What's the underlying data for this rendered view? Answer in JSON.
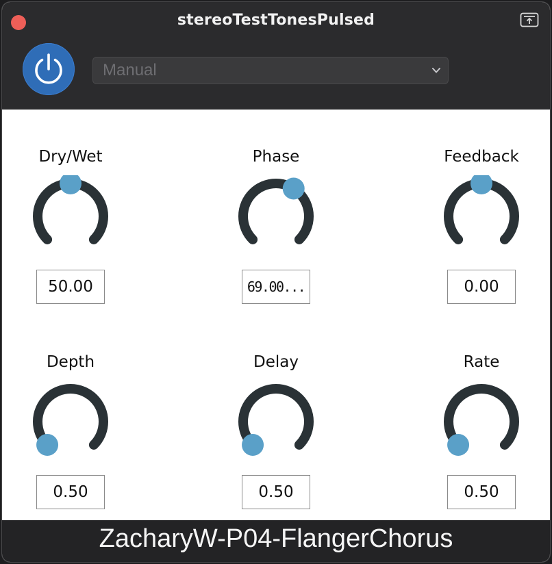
{
  "window": {
    "title": "stereoTestTonesPulsed",
    "footer_label": "ZacharyW-P04-FlangerChorus"
  },
  "toolbar": {
    "power_state": "on",
    "preset": {
      "selected": "Manual"
    }
  },
  "colors": {
    "knob_track": "#2a3236",
    "knob_track_dark": "#1a1f22",
    "knob_thumb": "#5aa0c8",
    "power_button": "#2f6db7",
    "close_button": "#ee5f58"
  },
  "parameters": [
    {
      "label": "Dry/Wet",
      "value": "50.00",
      "normalized": 0.5
    },
    {
      "label": "Phase",
      "value": "69.00...",
      "normalized": 0.62
    },
    {
      "label": "Feedback",
      "value": "0.00",
      "normalized": 0.5
    },
    {
      "label": "Depth",
      "value": "0.50",
      "normalized": 0.0
    },
    {
      "label": "Delay",
      "value": "0.50",
      "normalized": 0.0
    },
    {
      "label": "Rate",
      "value": "0.50",
      "normalized": 0.0
    }
  ]
}
